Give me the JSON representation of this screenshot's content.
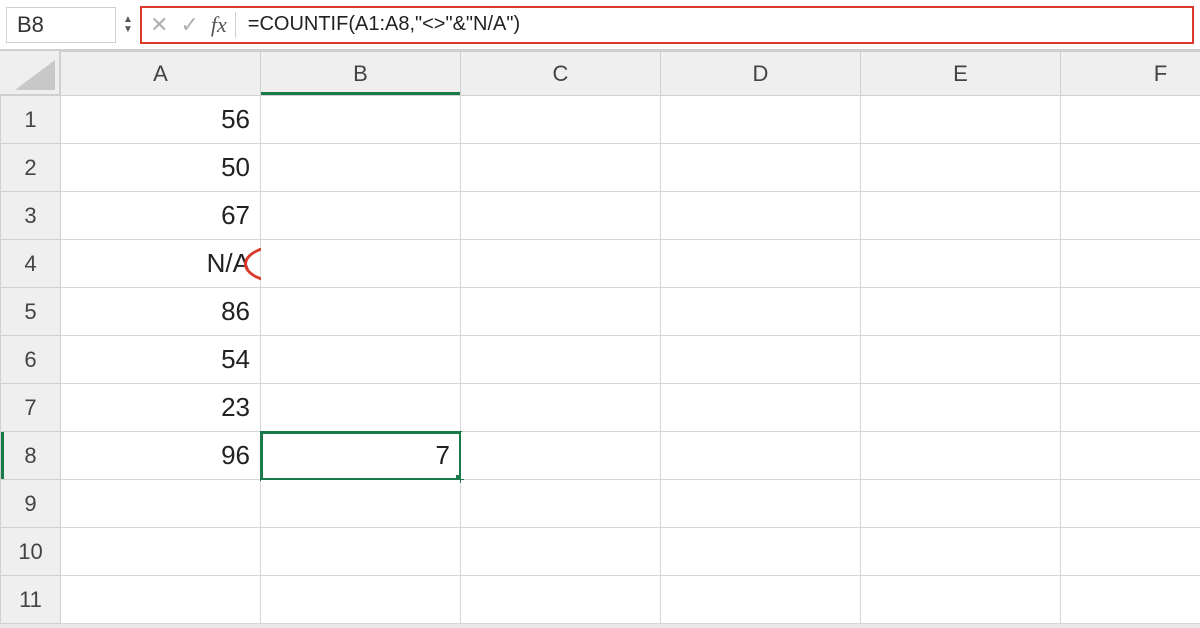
{
  "name_box": "B8",
  "formula": "=COUNTIF(A1:A8,\"<>\"&\"N/A\")",
  "fx_label": "fx",
  "cancel_glyph": "✕",
  "accept_glyph": "✓",
  "stepper_up": "▲",
  "stepper_down": "▼",
  "columns": [
    "A",
    "B",
    "C",
    "D",
    "E",
    "F"
  ],
  "rows": [
    "1",
    "2",
    "3",
    "4",
    "5",
    "6",
    "7",
    "8",
    "9",
    "10",
    "11"
  ],
  "active_cell": {
    "col": "B",
    "row": "8"
  },
  "cells": {
    "a1": "56",
    "a2": "50",
    "a3": "67",
    "a4": "N/A",
    "a5": "86",
    "a6": "54",
    "a7": "23",
    "a8": "96",
    "b8": "7"
  },
  "annotations": {
    "formula_bar_highlight": "#d93a2b",
    "na_circle_row": 4
  },
  "colors": {
    "selection": "#1a7a4a",
    "highlight": "#d93a2b"
  }
}
